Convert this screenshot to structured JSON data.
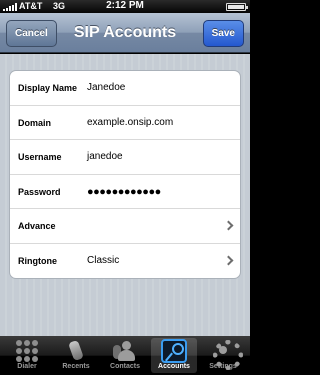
{
  "status_bar": {
    "carrier": "AT&T",
    "network": "3G",
    "time": "2:12 PM"
  },
  "nav": {
    "title": "SIP Accounts",
    "cancel_label": "Cancel",
    "save_label": "Save"
  },
  "form": {
    "rows": [
      {
        "label": "Display Name",
        "value": "Janedoe"
      },
      {
        "label": "Domain",
        "value": "example.onsip.com"
      },
      {
        "label": "Username",
        "value": "janedoe"
      },
      {
        "label": "Password",
        "value": "●●●●●●●●●●●●"
      },
      {
        "label": "Advance",
        "value": ""
      },
      {
        "label": "Ringtone",
        "value": "Classic"
      }
    ]
  },
  "tabs": [
    {
      "label": "Dialer",
      "icon": "dialer-icon"
    },
    {
      "label": "Recents",
      "icon": "recents-icon"
    },
    {
      "label": "Contacts",
      "icon": "contacts-icon"
    },
    {
      "label": "Accounts",
      "icon": "accounts-icon",
      "selected": true
    },
    {
      "label": "Settings",
      "icon": "settings-icon"
    }
  ],
  "colors": {
    "nav_bar": "#7f93ad",
    "save_button": "#2f62d6",
    "selected_tab_icon": "#3a9cf0",
    "background": "#c5ccd4"
  }
}
